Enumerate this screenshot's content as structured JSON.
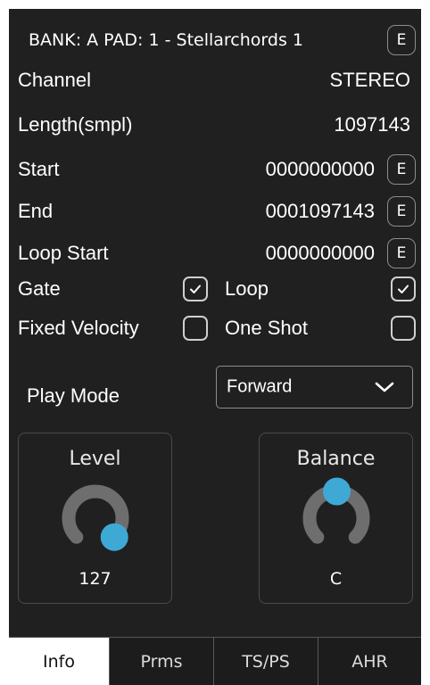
{
  "header": {
    "title": "BANK: A PAD: 1 - Stellarchords 1",
    "edit_label": "E"
  },
  "fields": [
    {
      "label": "Channel",
      "value": "STEREO"
    },
    {
      "label": "Length(smpl)",
      "value": "1097143"
    },
    {
      "label": "Start",
      "value": "0000000000",
      "edit_label": "E"
    },
    {
      "label": "End",
      "value": "0001097143",
      "edit_label": "E"
    },
    {
      "label": "Loop Start",
      "value": "0000000000",
      "edit_label": "E"
    }
  ],
  "options": {
    "gate": {
      "label": "Gate",
      "checked": true
    },
    "loop": {
      "label": "Loop",
      "checked": true
    },
    "fixed_velocity": {
      "label": "Fixed Velocity",
      "checked": false
    },
    "one_shot": {
      "label": "One Shot",
      "checked": false
    }
  },
  "play_mode": {
    "label": "Play Mode",
    "value": "Forward",
    "icon": "chevron-down-icon"
  },
  "knobs": {
    "level": {
      "title": "Level",
      "display": "127",
      "value": 127,
      "min": 0,
      "max": 127
    },
    "balance": {
      "title": "Balance",
      "display": "C",
      "value": 0,
      "min": -64,
      "max": 63
    }
  },
  "tabs": [
    {
      "label": "Info",
      "active": true
    },
    {
      "label": "Prms",
      "active": false
    },
    {
      "label": "TS/PS",
      "active": false
    },
    {
      "label": "AHR",
      "active": false
    }
  ],
  "colors": {
    "background": "#202020",
    "knob_track": "#6e6e6e",
    "knob_handle": "#3fa9d6",
    "active_tab": "#ffffff"
  }
}
